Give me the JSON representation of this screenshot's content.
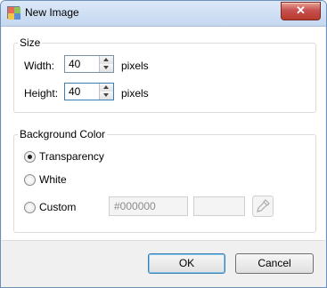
{
  "window": {
    "title": "New Image",
    "close_symbol": "✕"
  },
  "size_group": {
    "legend": "Size",
    "width": {
      "label": "Width:",
      "value": "40",
      "unit": "pixels"
    },
    "height": {
      "label": "Height:",
      "value": "40",
      "unit": "pixels"
    }
  },
  "background_group": {
    "legend": "Background Color",
    "options": [
      {
        "label": "Transparency",
        "selected": true
      },
      {
        "label": "White",
        "selected": false
      },
      {
        "label": "Custom",
        "selected": false
      }
    ],
    "custom_value": "#000000"
  },
  "buttons": {
    "ok": "OK",
    "cancel": "Cancel"
  },
  "colors": {
    "title_bar": "#c5d8f0",
    "close_button": "#c75050",
    "default_button_border": "#3c7fb1"
  }
}
